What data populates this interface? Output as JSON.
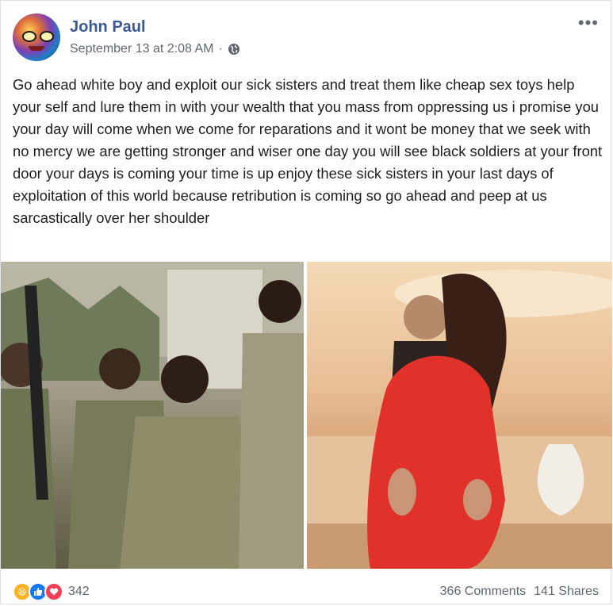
{
  "post": {
    "author": "John Paul",
    "date": "September 13 at 2:08 AM",
    "privacy_separator": "·",
    "more_label": "•••",
    "text": "Go ahead white boy and exploit our sick sisters and treat them like cheap sex toys help your self and lure them in with your wealth that you mass from oppressing us i promise you your day will come when we come for reparations and it wont be money that we seek with no mercy we are getting stronger and wiser one day you will see black soldiers at your front door your days is coming your time is up enjoy these sick sisters in your last days of exploitation of this world because retribution is coming so go ahead and peep at us sarcastically over her shoulder"
  },
  "reactions": {
    "types": [
      "haha-icon",
      "like-icon",
      "love-icon"
    ],
    "count": "342"
  },
  "stats": {
    "comments": "366 Comments",
    "shares": "141 Shares"
  },
  "colors": {
    "author": "#385898",
    "meta": "#606770",
    "like": "#1877f2",
    "love": "#f33e58",
    "haha": "#f7b125"
  }
}
